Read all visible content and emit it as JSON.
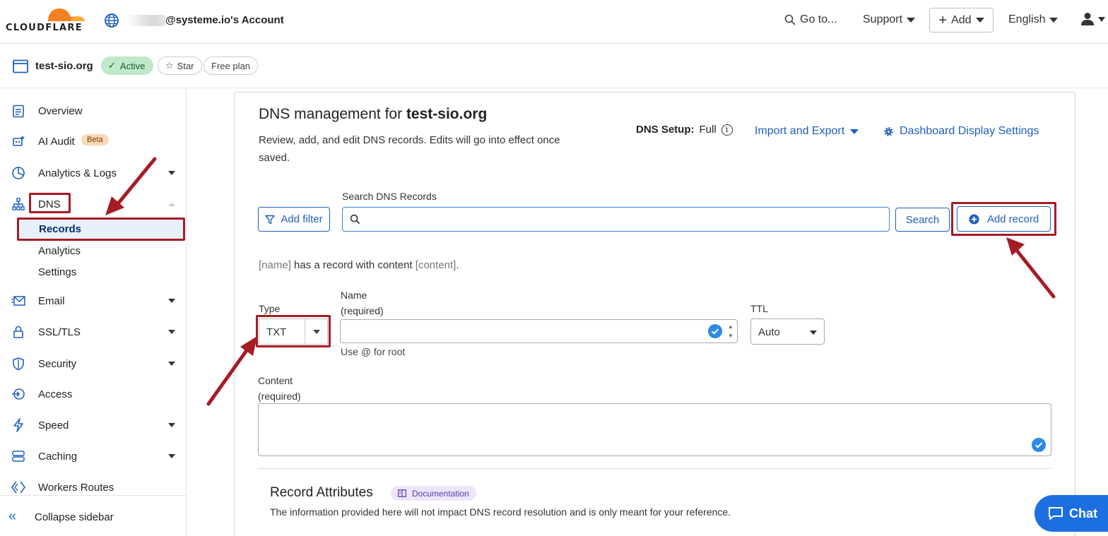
{
  "topnav": {
    "logo_text": "CLOUDFLARE",
    "account_name": "@systeme.io's Account",
    "goto_label": "Go to...",
    "support_label": "Support",
    "add_label": "Add",
    "language_label": "English"
  },
  "zone": {
    "name": "test-sio.org",
    "status": "Active",
    "star_label": "Star",
    "plan": "Free plan"
  },
  "sidebar": {
    "items": [
      {
        "label": "Overview"
      },
      {
        "label": "AI Audit",
        "badge": "Beta"
      },
      {
        "label": "Analytics & Logs"
      },
      {
        "label": "DNS"
      },
      {
        "label": "Email"
      },
      {
        "label": "SSL/TLS"
      },
      {
        "label": "Security"
      },
      {
        "label": "Access"
      },
      {
        "label": "Speed"
      },
      {
        "label": "Caching"
      },
      {
        "label": "Workers Routes"
      }
    ],
    "dns_sub": [
      "Records",
      "Analytics",
      "Settings"
    ],
    "collapse_label": "Collapse sidebar"
  },
  "main": {
    "title_prefix": "DNS management for ",
    "title_zone": "test-sio.org",
    "subtitle": "Review, add, and edit DNS records. Edits will go into effect once saved.",
    "dns_setup_label": "DNS Setup:",
    "dns_setup_value": "Full",
    "import_export": "Import and Export",
    "dashboard_settings": "Dashboard Display Settings",
    "search_label": "Search DNS Records",
    "search_placeholder": "",
    "add_filter": "Add filter",
    "search_button": "Search",
    "add_record": "Add record",
    "hint_name": "[name]",
    "hint_mid": " has a record with content ",
    "hint_content": "[content]",
    "hint_end": ".",
    "type_label": "Type",
    "type_value": "TXT",
    "name_label": "Name",
    "name_required": "(required)",
    "name_value": "",
    "use_root": "Use @ for root",
    "ttl_label": "TTL",
    "ttl_value": "Auto",
    "content_label": "Content",
    "content_required": "(required)",
    "attributes_title": "Record Attributes",
    "documentation": "Documentation",
    "attributes_desc": "The information provided here will not impact DNS record resolution and is only meant for your reference."
  },
  "chat_label": "Chat",
  "colors": {
    "accent": "#1f5fbd",
    "annotation": "#a51c24",
    "active_badge": "#bfe9c9",
    "chat": "#1c6fe0"
  }
}
